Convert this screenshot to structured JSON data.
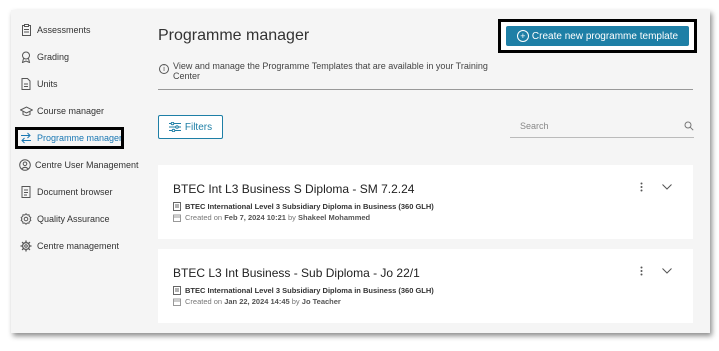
{
  "sidebar": {
    "items": [
      {
        "label": "Assessments",
        "icon": "clipboard-icon"
      },
      {
        "label": "Grading",
        "icon": "award-icon"
      },
      {
        "label": "Units",
        "icon": "file-icon"
      },
      {
        "label": "Course manager",
        "icon": "graduation-cap-icon"
      },
      {
        "label": "Programme manager",
        "icon": "swap-arrows-icon",
        "active": true
      },
      {
        "label": "Centre User Management",
        "icon": "user-circle-icon"
      },
      {
        "label": "Document browser",
        "icon": "document-icon"
      },
      {
        "label": "Quality Assurance",
        "icon": "badge-icon"
      },
      {
        "label": "Centre management",
        "icon": "gear-icon"
      }
    ]
  },
  "header": {
    "title": "Programme manager",
    "create_label": "Create new programme template"
  },
  "info": {
    "text": "View and manage the Programme Templates that are available in your Training Center"
  },
  "filters": {
    "label": "Filters"
  },
  "search": {
    "placeholder": "Search"
  },
  "cards": [
    {
      "title": "BTEC Int L3 Business S Diploma - SM 7.2.24",
      "subtitle": "BTEC International Level 3 Subsidiary Diploma in Business (360 GLH)",
      "created_prefix": "Created on",
      "created_date": "Feb 7, 2024 10:21",
      "by": "by",
      "author": "Shakeel Mohammed"
    },
    {
      "title": "BTEC L3 Int Business - Sub Diploma - Jo 22/1",
      "subtitle": "BTEC International Level 3 Subsidiary Diploma in Business (360 GLH)",
      "created_prefix": "Created on",
      "created_date": "Jan 22, 2024 14:45",
      "by": "by",
      "author": "Jo Teacher"
    }
  ],
  "colors": {
    "accent": "#1e7fa6",
    "active_nav": "#1a78b4",
    "background": "#f5f5f5"
  }
}
